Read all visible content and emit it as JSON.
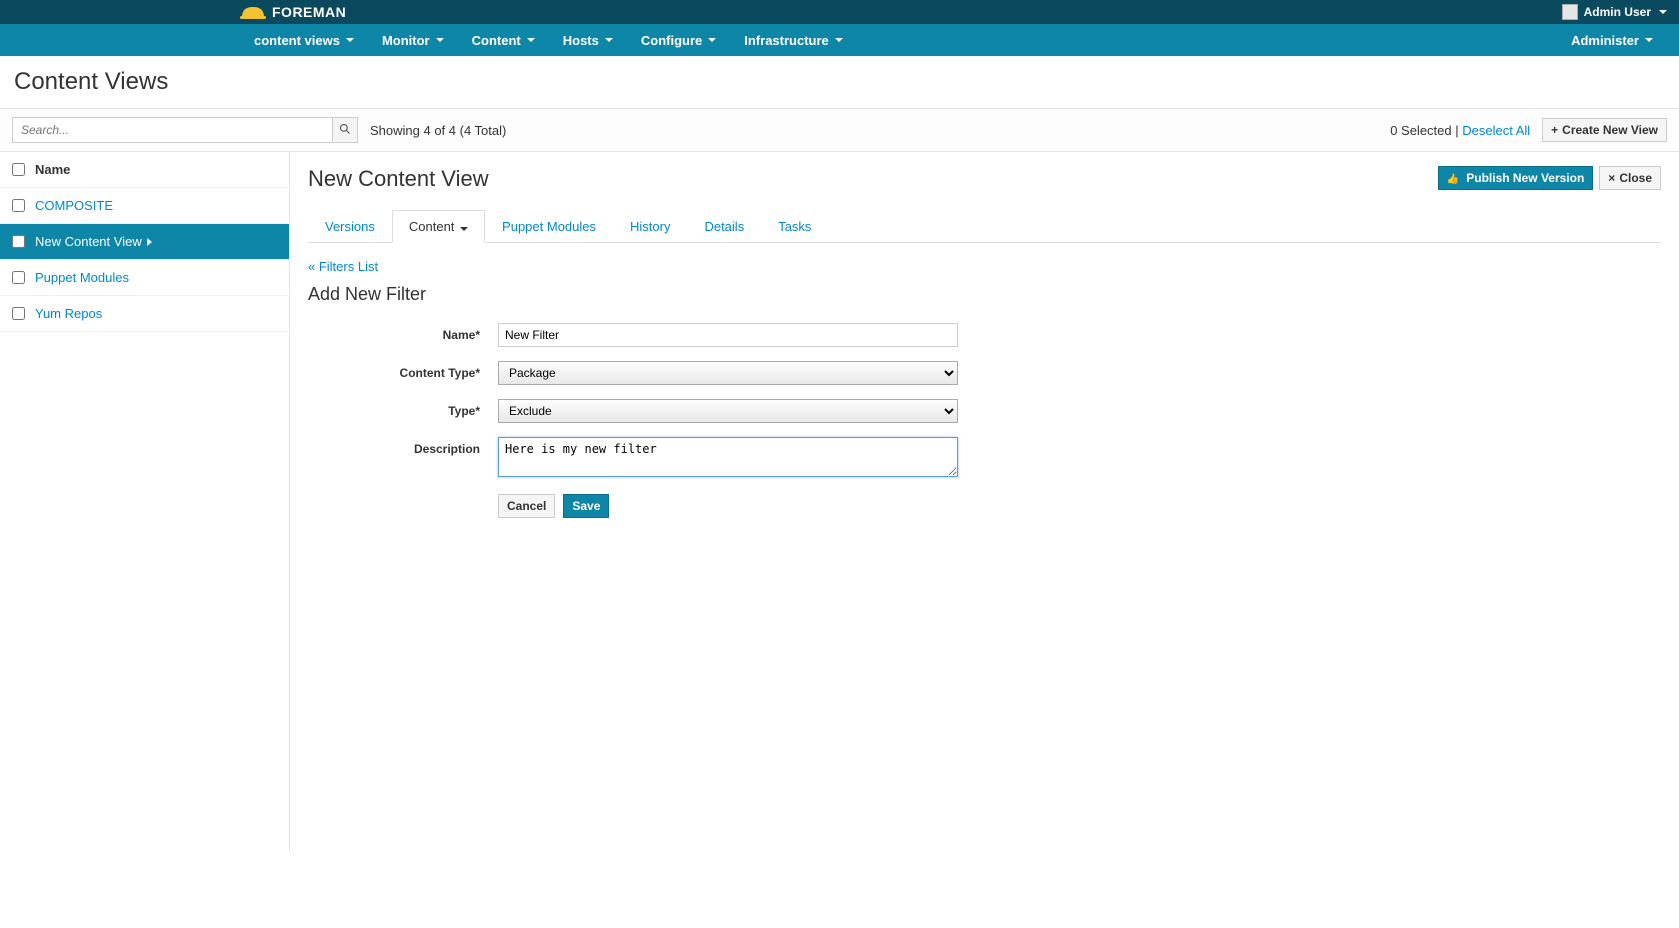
{
  "topbar": {
    "brand": "FOREMAN",
    "user_label": "Admin User"
  },
  "mainnav": {
    "context": "content views",
    "items": [
      "Monitor",
      "Content",
      "Hosts",
      "Configure",
      "Infrastructure"
    ],
    "right": "Administer"
  },
  "page": {
    "title": "Content Views"
  },
  "toolbar": {
    "search_placeholder": "Search...",
    "showing": "Showing 4 of 4 (4 Total)",
    "selected": "0 Selected",
    "deselect": "Deselect All",
    "create": "Create New View"
  },
  "sidebar": {
    "header": "Name",
    "items": [
      {
        "label": "COMPOSITE",
        "active": false
      },
      {
        "label": "New Content View",
        "active": true
      },
      {
        "label": "Puppet Modules",
        "active": false
      },
      {
        "label": "Yum Repos",
        "active": false
      }
    ]
  },
  "main": {
    "heading": "New Content View",
    "publish": "Publish New Version",
    "close": "Close",
    "tabs": [
      "Versions",
      "Content",
      "Puppet Modules",
      "History",
      "Details",
      "Tasks"
    ],
    "active_tab": "Content",
    "filters_link": "« Filters List",
    "form_title": "Add New Filter",
    "form": {
      "name_label": "Name*",
      "name_value": "New Filter",
      "content_type_label": "Content Type*",
      "content_type_value": "Package",
      "type_label": "Type*",
      "type_value": "Exclude",
      "description_label": "Description",
      "description_value": "Here is my new filter",
      "cancel": "Cancel",
      "save": "Save"
    }
  }
}
